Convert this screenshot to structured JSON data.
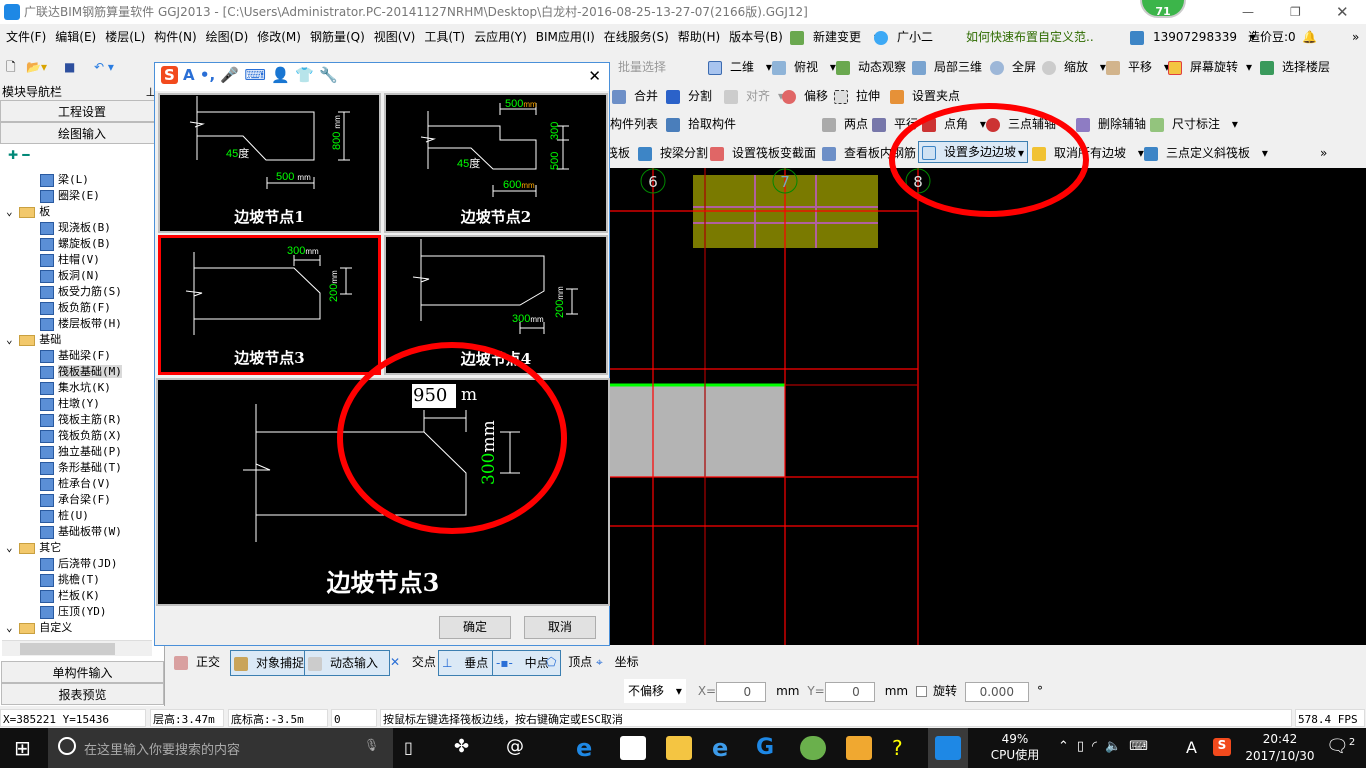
{
  "window": {
    "title": "广联达BIM钢筋算量软件 GGJ2013 - [C:\\Users\\Administrator.PC-20141127NRHM\\Desktop\\白龙村-2016-08-25-13-27-07(2166版).GGJ12]",
    "badge": "71"
  },
  "menu": [
    "文件(F)",
    "编辑(E)",
    "楼层(L)",
    "构件(N)",
    "绘图(D)",
    "修改(M)",
    "钢筋量(Q)",
    "视图(V)",
    "工具(T)",
    "云应用(Y)",
    "BIM应用(I)",
    "在线服务(S)",
    "帮助(H)",
    "版本号(B)"
  ],
  "menu_extra": {
    "new_change": "新建变更",
    "assistant": "广小二",
    "tip": "如何快速布置自定义范..",
    "account": "13907298339",
    "beans": "造价豆:0"
  },
  "toolbar1": {
    "batch_select": "批量选择",
    "view2d": "二维",
    "top_view": "俯视",
    "dynamic_view": "动态观察",
    "local3d": "局部三维",
    "fullscreen": "全屏",
    "zoom": "缩放",
    "pan": "平移",
    "rotate": "屏幕旋转",
    "select_floor": "选择楼层"
  },
  "toolbar2": {
    "merge": "合并",
    "split": "分割",
    "align": "对齐",
    "offset": "偏移",
    "stretch": "拉伸",
    "set_grip": "设置夹点"
  },
  "toolbar3": {
    "component_list": "构件列表",
    "pick_component": "拾取构件",
    "two_points": "两点",
    "parallel": "平行",
    "point_angle": "点角",
    "three_point_axis": "三点辅轴",
    "delete_axis": "删除辅轴",
    "dimension": "尺寸标注"
  },
  "toolbar4": {
    "slab": "筏板",
    "split_by_beam": "按梁分割",
    "set_section": "设置筏板变截面",
    "view_rebar": "查看板内钢筋",
    "set_multi_slope": "设置多边边坡",
    "cancel_slopes": "取消所有边坡",
    "three_point_slope": "三点定义斜筏板"
  },
  "left_panel": {
    "title": "模块导航栏",
    "project_settings": "工程设置",
    "drawing_input": "绘图输入",
    "single_input": "单构件输入",
    "report_preview": "报表预览",
    "tree": [
      {
        "label": "梁(L)",
        "level": 2
      },
      {
        "label": "圈梁(E)",
        "level": 2
      },
      {
        "label": "板",
        "level": 1
      },
      {
        "label": "现浇板(B)",
        "level": 2
      },
      {
        "label": "螺旋板(B)",
        "level": 2
      },
      {
        "label": "柱帽(V)",
        "level": 2
      },
      {
        "label": "板洞(N)",
        "level": 2
      },
      {
        "label": "板受力筋(S)",
        "level": 2
      },
      {
        "label": "板负筋(F)",
        "level": 2
      },
      {
        "label": "楼层板带(H)",
        "level": 2
      },
      {
        "label": "基础",
        "level": 1
      },
      {
        "label": "基础梁(F)",
        "level": 2
      },
      {
        "label": "筏板基础(M)",
        "level": 2,
        "selected": true
      },
      {
        "label": "集水坑(K)",
        "level": 2
      },
      {
        "label": "柱墩(Y)",
        "level": 2
      },
      {
        "label": "筏板主筋(R)",
        "level": 2
      },
      {
        "label": "筏板负筋(X)",
        "level": 2
      },
      {
        "label": "独立基础(P)",
        "level": 2
      },
      {
        "label": "条形基础(T)",
        "level": 2
      },
      {
        "label": "桩承台(V)",
        "level": 2
      },
      {
        "label": "承台梁(F)",
        "level": 2
      },
      {
        "label": "桩(U)",
        "level": 2
      },
      {
        "label": "基础板带(W)",
        "level": 2
      },
      {
        "label": "其它",
        "level": 1
      },
      {
        "label": "后浇带(JD)",
        "level": 2
      },
      {
        "label": "挑檐(T)",
        "level": 2
      },
      {
        "label": "栏板(K)",
        "level": 2
      },
      {
        "label": "压顶(YD)",
        "level": 2
      },
      {
        "label": "自定义",
        "level": 1
      }
    ]
  },
  "dialog": {
    "tiles": [
      {
        "caption": "边坡节点1",
        "angle": "45",
        "angle_unit": "度",
        "dim_h": "500",
        "dim_h_unit": "mm",
        "dim_v": "800",
        "dim_v_unit": "mm"
      },
      {
        "caption": "边坡节点2",
        "angle": "45",
        "angle_unit": "度",
        "dim_top": "500",
        "dim_bottom": "600",
        "dim_v1": "300",
        "dim_v2": "500",
        "unit": "mm"
      },
      {
        "caption": "边坡节点3",
        "dim_h": "300",
        "dim_v": "200",
        "unit": "mm",
        "selected": true
      },
      {
        "caption": "边坡节点4",
        "dim_h": "300",
        "dim_v": "200",
        "unit": "mm"
      }
    ],
    "preview": {
      "caption": "边坡节点3",
      "width_value": "950",
      "width_unit": "m",
      "height_value": "300",
      "height_unit": "mm"
    },
    "ok": "确定",
    "cancel": "取消"
  },
  "canvas": {
    "axes": [
      "6",
      "7",
      "8"
    ]
  },
  "snap_toolbar": {
    "ortho": "正交",
    "object_snap": "对象捕捉",
    "dynamic_input": "动态输入",
    "intersection": "交点",
    "perpendicular": "垂点",
    "midpoint": "中点",
    "vertex": "顶点",
    "coordinate": "坐标"
  },
  "offset_toolbar": {
    "mode": "不偏移",
    "x_label": "X=",
    "x_value": "0",
    "y_label": "Y=",
    "y_value": "0",
    "unit": "mm",
    "rotate_label": "旋转",
    "rotate_value": "0.000",
    "degree": "°"
  },
  "status": {
    "coords": "X=385221 Y=15436",
    "floor_height": "层高:3.47m",
    "bottom_elev": "底标高:-3.5m",
    "value": "0",
    "hint": "按鼠标左键选择筏板边线，按右键确定或ESC取消",
    "fps": "578.4 FPS"
  },
  "taskbar": {
    "search_placeholder": "在这里输入你要搜索的内容",
    "cpu_percent": "49%",
    "cpu_label": "CPU使用",
    "ime": "A",
    "time": "20:42",
    "date": "2017/10/30",
    "notifications": "2"
  },
  "colors": {
    "annotation": "#ff0000",
    "dim_text": "#00ff00",
    "canvas": "#000000",
    "slab": "#7a7a00",
    "selected_tile": "#ff0000"
  }
}
